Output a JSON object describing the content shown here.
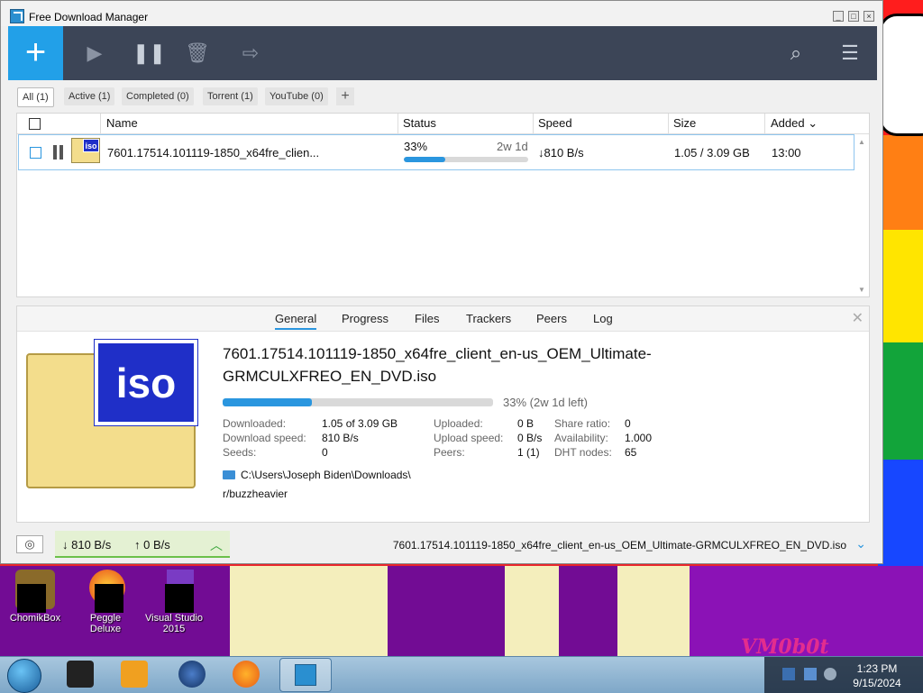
{
  "window": {
    "title": "Free Download Manager"
  },
  "toolbar": {
    "add_label": "+"
  },
  "filters": [
    {
      "label": "All (1)"
    },
    {
      "label": "Active (1)"
    },
    {
      "label": "Completed (0)"
    },
    {
      "label": "Torrent (1)"
    },
    {
      "label": "YouTube (0)"
    }
  ],
  "add_filter_label": "+",
  "columns": {
    "name": "Name",
    "status": "Status",
    "speed": "Speed",
    "size": "Size",
    "added": "Added ⌄"
  },
  "download": {
    "icon_label": "iso",
    "name": "7601.17514.101119-1850_x64fre_clien...",
    "status_pct": "33%",
    "eta": "2w 1d",
    "progress": 0.33,
    "speed": "↓810 B/s",
    "size": "1.05 / 3.09 GB",
    "added": "13:00"
  },
  "detail_tabs": [
    "General",
    "Progress",
    "Files",
    "Trackers",
    "Peers",
    "Log"
  ],
  "details": {
    "close": "✕",
    "icon_label": "iso",
    "file_name": "7601.17514.101119-1850_x64fre_client_en-us_OEM_Ultimate-GRMCULXFREO_EN_DVD.iso",
    "progress": 0.33,
    "progress_text": "33% (2w 1d left)",
    "downloaded_label": "Downloaded:",
    "downloaded": "1.05 of 3.09 GB",
    "download_speed_label": "Download speed:",
    "download_speed": "810 B/s",
    "seeds_label": "Seeds:",
    "seeds": "0",
    "uploaded_label": "Uploaded:",
    "uploaded": "0 B",
    "upload_speed_label": "Upload speed:",
    "upload_speed": "0 B/s",
    "peers_label": "Peers:",
    "peers": "1 (1)",
    "share_ratio_label": "Share ratio:",
    "share_ratio": "0",
    "availability_label": "Availability:",
    "availability": "1.000",
    "dht_label": "DHT nodes:",
    "dht": "65",
    "path": "C:\\Users\\Joseph Biden\\Downloads\\",
    "comment": "r/buzzheavier"
  },
  "statusbar": {
    "down": "↓  810 B/s",
    "up": "↑  0 B/s",
    "current_file": "7601.17514.101119-1850_x64fre_client_en-us_OEM_Ultimate-GRMCULXFREO_EN_DVD.iso"
  },
  "desktop_icons": [
    {
      "label": "ChomikBox"
    },
    {
      "label": "Peggle Deluxe"
    },
    {
      "label": "Visual Studio 2015"
    }
  ],
  "watermark": "VM0b0t",
  "clock": {
    "time": "1:23 PM",
    "date": "9/15/2024"
  },
  "colors": {
    "accent": "#22a0e8",
    "toolbar": "#3c4557",
    "progress": "#2a96df"
  }
}
